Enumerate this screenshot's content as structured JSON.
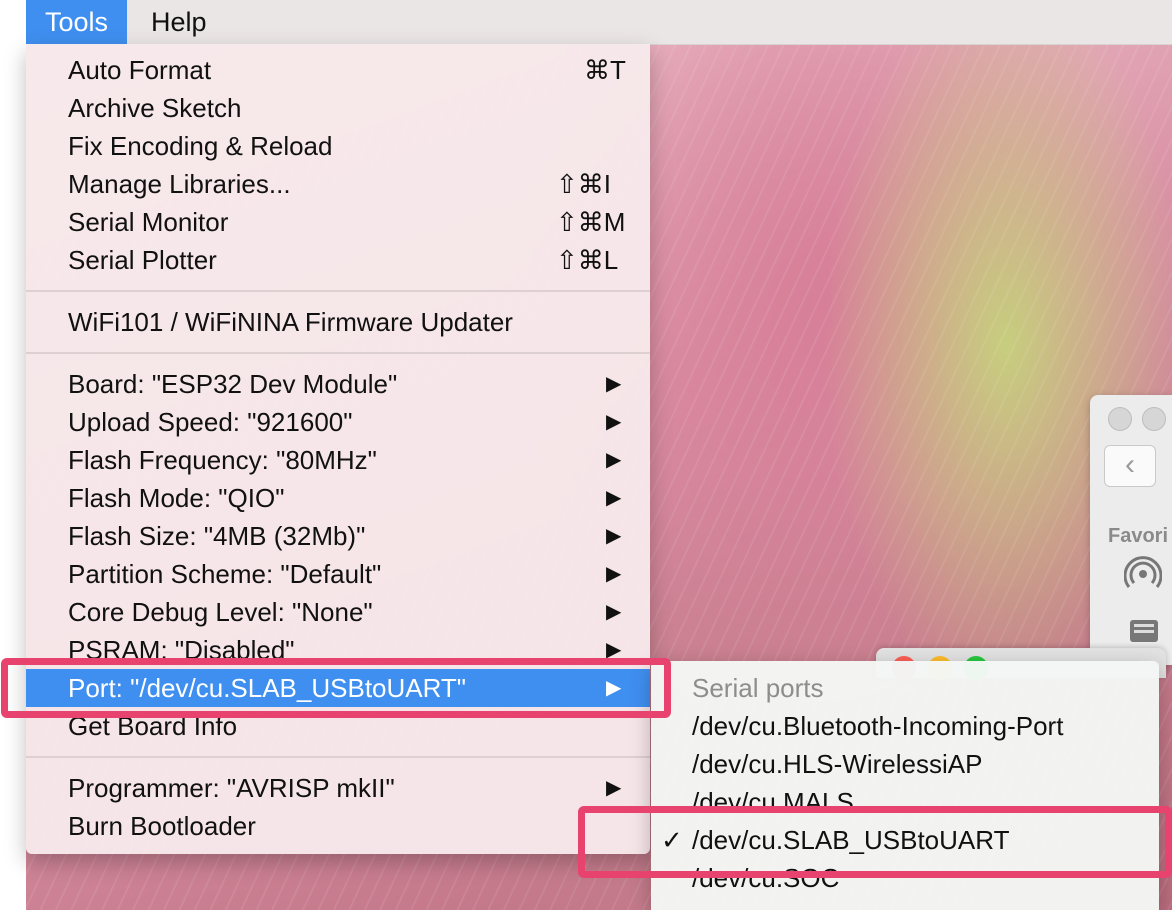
{
  "menubar": {
    "tools": "Tools",
    "help": "Help"
  },
  "tools_menu": {
    "group1": [
      {
        "label": "Auto Format",
        "shortcut": "⌘T"
      },
      {
        "label": "Archive Sketch",
        "shortcut": ""
      },
      {
        "label": "Fix Encoding & Reload",
        "shortcut": ""
      },
      {
        "label": "Manage Libraries...",
        "shortcut": "⇧⌘I"
      },
      {
        "label": "Serial Monitor",
        "shortcut": "⇧⌘M"
      },
      {
        "label": "Serial Plotter",
        "shortcut": "⇧⌘L"
      }
    ],
    "group2": [
      {
        "label": "WiFi101 / WiFiNINA Firmware Updater"
      }
    ],
    "group3": [
      {
        "label": "Board: \"ESP32 Dev Module\"",
        "arrow": "▶"
      },
      {
        "label": "Upload Speed: \"921600\"",
        "arrow": "▶"
      },
      {
        "label": "Flash Frequency: \"80MHz\"",
        "arrow": "▶"
      },
      {
        "label": "Flash Mode: \"QIO\"",
        "arrow": "▶"
      },
      {
        "label": "Flash Size: \"4MB (32Mb)\"",
        "arrow": "▶"
      },
      {
        "label": "Partition Scheme: \"Default\"",
        "arrow": "▶"
      },
      {
        "label": "Core Debug Level: \"None\"",
        "arrow": "▶"
      },
      {
        "label": "PSRAM: \"Disabled\"",
        "arrow": "▶"
      },
      {
        "label": "Port: \"/dev/cu.SLAB_USBtoUART\"",
        "arrow": "▶"
      },
      {
        "label": "Get Board Info",
        "arrow": ""
      }
    ],
    "group4": [
      {
        "label": "Programmer: \"AVRISP mkII\"",
        "arrow": "▶"
      },
      {
        "label": "Burn Bootloader",
        "arrow": ""
      }
    ]
  },
  "port_submenu": {
    "header": "Serial ports",
    "items": [
      {
        "label": "/dev/cu.Bluetooth-Incoming-Port",
        "check": ""
      },
      {
        "label": "/dev/cu.HLS-WirelessiAP",
        "check": ""
      },
      {
        "label": "/dev/cu.MALS",
        "check": ""
      },
      {
        "label": "/dev/cu.SLAB_USBtoUART",
        "check": "✓"
      },
      {
        "label": "/dev/cu.SOC",
        "check": ""
      }
    ]
  },
  "finder": {
    "back": "‹",
    "favorites": "Favori"
  },
  "colors": {
    "selection": "#3f8ff0",
    "annotation": "#e8436f"
  },
  "icons": {
    "airdrop": "airdrop-icon",
    "drive": "drive-icon"
  }
}
